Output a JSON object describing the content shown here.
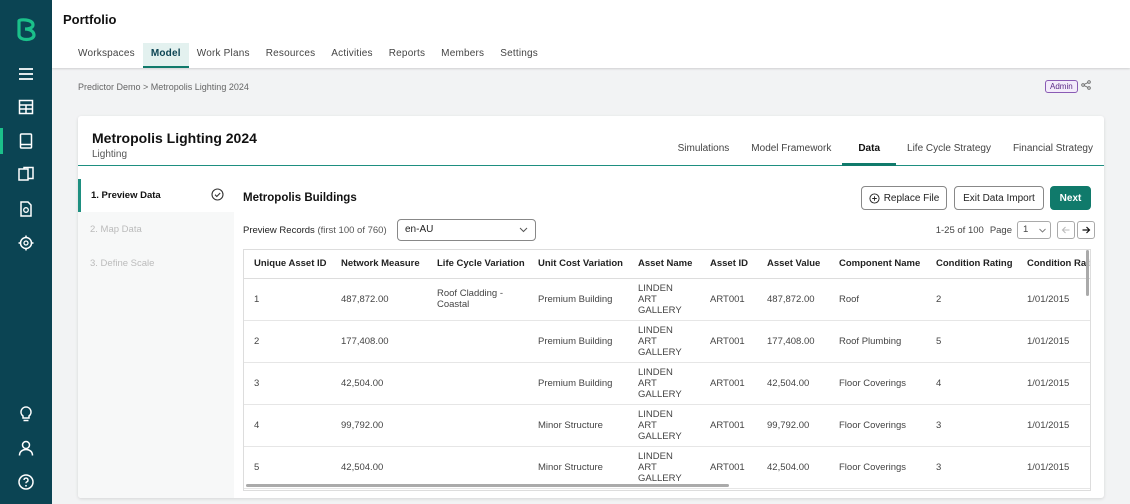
{
  "app": {
    "title": "Portfolio"
  },
  "nav": [
    {
      "label": "Workspaces"
    },
    {
      "label": "Model",
      "active": true
    },
    {
      "label": "Work Plans"
    },
    {
      "label": "Resources"
    },
    {
      "label": "Activities"
    },
    {
      "label": "Reports"
    },
    {
      "label": "Members"
    },
    {
      "label": "Settings"
    }
  ],
  "breadcrumb": {
    "text": "Predictor Demo > Metropolis Lighting 2024"
  },
  "badge": {
    "label": "Admin"
  },
  "project": {
    "title": "Metropolis Lighting 2024",
    "subtitle": "Lighting"
  },
  "tabs": [
    {
      "label": "Simulations"
    },
    {
      "label": "Model Framework"
    },
    {
      "label": "Data",
      "active": true
    },
    {
      "label": "Life Cycle Strategy"
    },
    {
      "label": "Financial Strategy"
    }
  ],
  "steps": [
    {
      "label": "1. Preview Data",
      "active": true
    },
    {
      "label": "2. Map Data"
    },
    {
      "label": "3. Define Scale"
    }
  ],
  "section": {
    "title": "Metropolis Buildings",
    "replace_label": "Replace File",
    "exit_label": "Exit Data Import",
    "next_label": "Next",
    "preview_label": "Preview Records",
    "preview_count": "(first 100 of 760)",
    "locale": "en-AU"
  },
  "pager": {
    "range": "1-25 of 100",
    "page_label": "Page",
    "page": "1"
  },
  "table": {
    "columns": [
      "Unique Asset ID",
      "Network Measure",
      "Life Cycle Variation",
      "Unit Cost Variation",
      "Asset Name",
      "Asset ID",
      "Asset Value",
      "Component Name",
      "Condition Rating",
      "Condition Rati"
    ],
    "rows": [
      [
        "1",
        "487,872.00",
        "Roof Cladding - Coastal",
        "Premium Building",
        "LINDEN ART GALLERY",
        "ART001",
        "487,872.00",
        "Roof",
        "2",
        "1/01/2015"
      ],
      [
        "2",
        "177,408.00",
        "",
        "Premium Building",
        "LINDEN ART GALLERY",
        "ART001",
        "177,408.00",
        "Roof Plumbing",
        "5",
        "1/01/2015"
      ],
      [
        "3",
        "42,504.00",
        "",
        "Premium Building",
        "LINDEN ART GALLERY",
        "ART001",
        "42,504.00",
        "Floor Coverings",
        "4",
        "1/01/2015"
      ],
      [
        "4",
        "99,792.00",
        "",
        "Minor Structure",
        "LINDEN ART GALLERY",
        "ART001",
        "99,792.00",
        "Floor Coverings",
        "3",
        "1/01/2015"
      ],
      [
        "5",
        "42,504.00",
        "",
        "Minor Structure",
        "LINDEN ART GALLERY",
        "ART001",
        "42,504.00",
        "Floor Coverings",
        "3",
        "1/01/2015"
      ]
    ]
  },
  "colors": {
    "sidebar": "#0b4453",
    "accent": "#107a6b",
    "active_indicator": "#1bc08a"
  },
  "icons": [
    "logo-icon",
    "menu-icon",
    "grid-icon",
    "book-icon",
    "copy-icon",
    "report-icon",
    "settings-icon",
    "bulb-icon",
    "user-icon",
    "help-icon"
  ]
}
